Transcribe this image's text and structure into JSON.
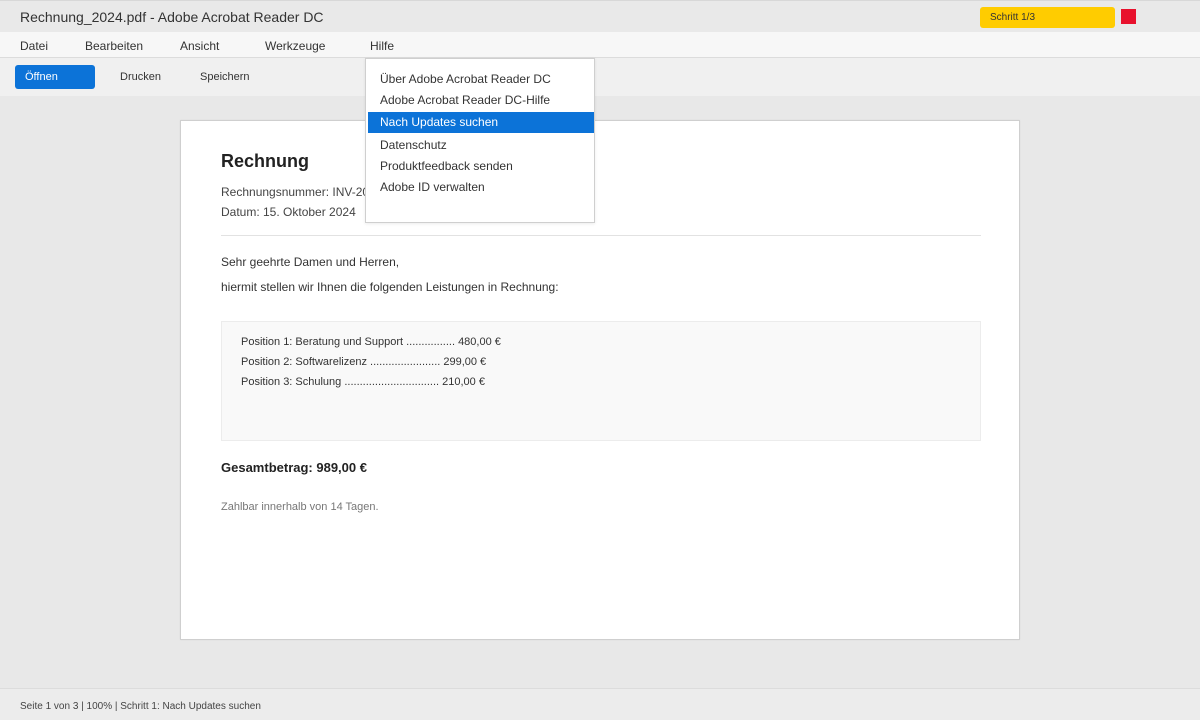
{
  "window": {
    "title": "Rechnung_2024.pdf - Adobe Acrobat Reader DC"
  },
  "step_badge": "Schritt 1/3",
  "colors": {
    "accent": "#0c73d8",
    "badge": "#ffcc00",
    "red_marker": "#e8112d"
  },
  "menubar": [
    "Datei",
    "Bearbeiten",
    "Ansicht",
    "Werkzeuge",
    "Hilfe"
  ],
  "toolbar": {
    "open": "Öffnen",
    "print": "Drucken",
    "save": "Speichern"
  },
  "help_menu": {
    "items": [
      "Über Adobe Acrobat Reader DC",
      "Adobe Acrobat Reader DC-Hilfe",
      "Nach Updates suchen",
      "Datenschutz",
      "Produktfeedback senden",
      "Adobe ID verwalten"
    ],
    "selected": "Nach Updates suchen"
  },
  "document": {
    "title": "Rechnung",
    "invoice_number": "Rechnungsnummer: INV-20",
    "date": "Datum: 15. Oktober 2024",
    "greeting": "Sehr geehrte Damen und Herren,",
    "intro": "hiermit stellen wir Ihnen die folgenden Leistungen in Rechnung:",
    "items": [
      "Position 1: Beratung und Support ................ 480,00 €",
      "Position 2: Softwarelizenz ....................... 299,00 €",
      "Position 3: Schulung ............................... 210,00 €"
    ],
    "total": "Gesamtbetrag: 989,00 €",
    "payment_note": "Zahlbar innerhalb von 14 Tagen."
  },
  "status": "Seite 1 von 3 | 100% | Schritt 1: Nach Updates suchen"
}
